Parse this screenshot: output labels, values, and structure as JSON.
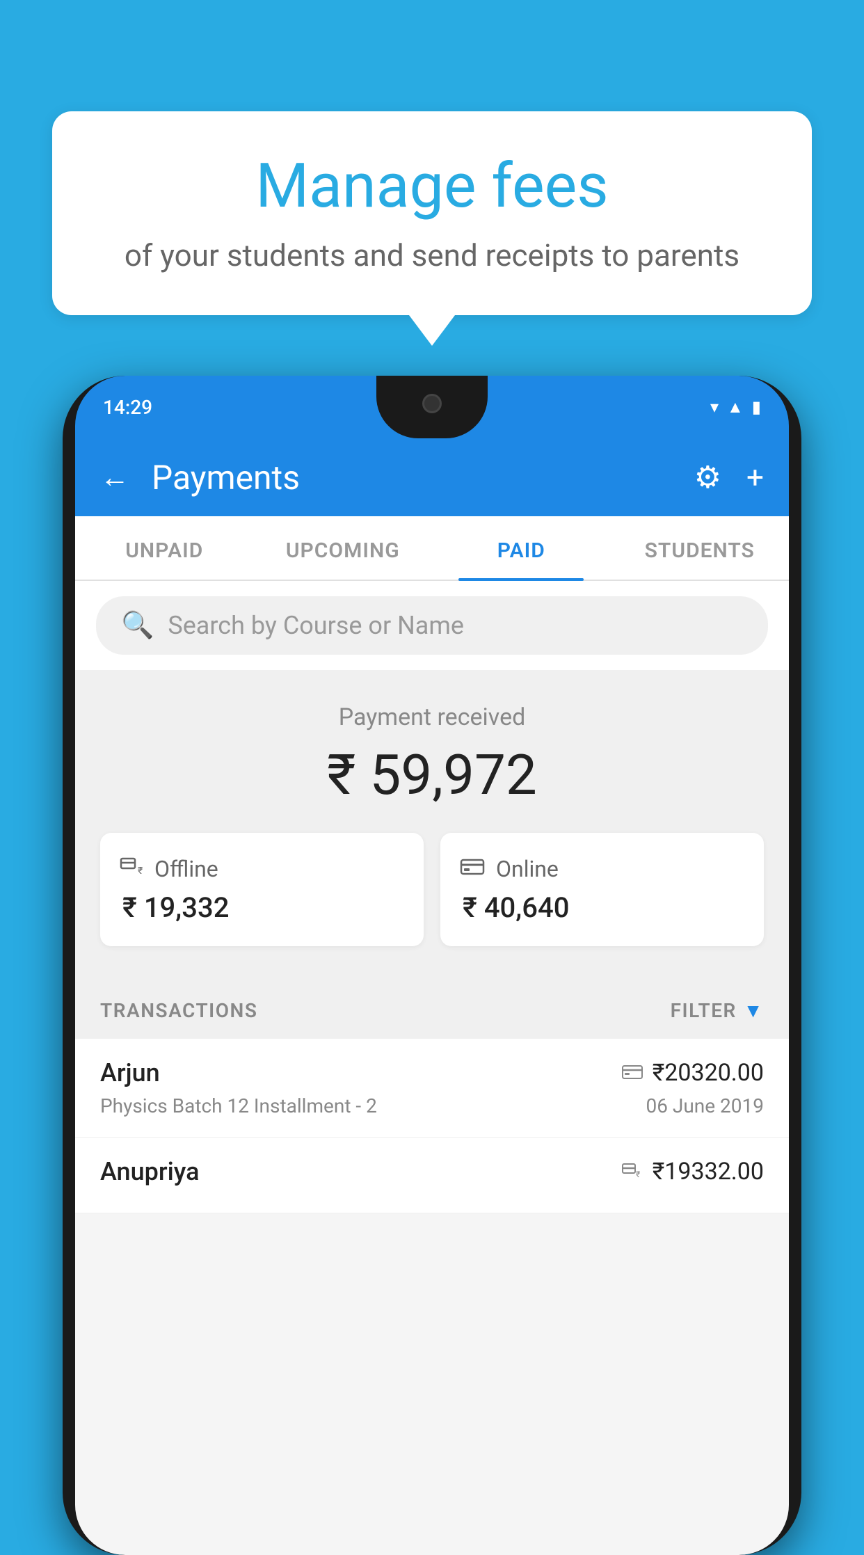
{
  "background_color": "#29ABE2",
  "speech_bubble": {
    "title": "Manage fees",
    "subtitle": "of your students and send receipts to parents"
  },
  "phone": {
    "status_bar": {
      "time": "14:29",
      "icons": [
        "wifi",
        "signal",
        "battery"
      ]
    },
    "header": {
      "back_label": "←",
      "title": "Payments",
      "settings_icon": "⚙",
      "add_icon": "+"
    },
    "tabs": [
      {
        "label": "UNPAID",
        "active": false
      },
      {
        "label": "UPCOMING",
        "active": false
      },
      {
        "label": "PAID",
        "active": true
      },
      {
        "label": "STUDENTS",
        "active": false
      }
    ],
    "search": {
      "placeholder": "Search by Course or Name"
    },
    "payment_summary": {
      "label": "Payment received",
      "amount": "₹ 59,972",
      "offline_label": "Offline",
      "offline_amount": "₹ 19,332",
      "online_label": "Online",
      "online_amount": "₹ 40,640"
    },
    "transactions_section": {
      "label": "TRANSACTIONS",
      "filter_label": "FILTER"
    },
    "transactions": [
      {
        "name": "Arjun",
        "amount": "₹20320.00",
        "course": "Physics Batch 12 Installment - 2",
        "date": "06 June 2019",
        "payment_type": "online"
      },
      {
        "name": "Anupriya",
        "amount": "₹19332.00",
        "course": "",
        "date": "",
        "payment_type": "offline"
      }
    ]
  }
}
